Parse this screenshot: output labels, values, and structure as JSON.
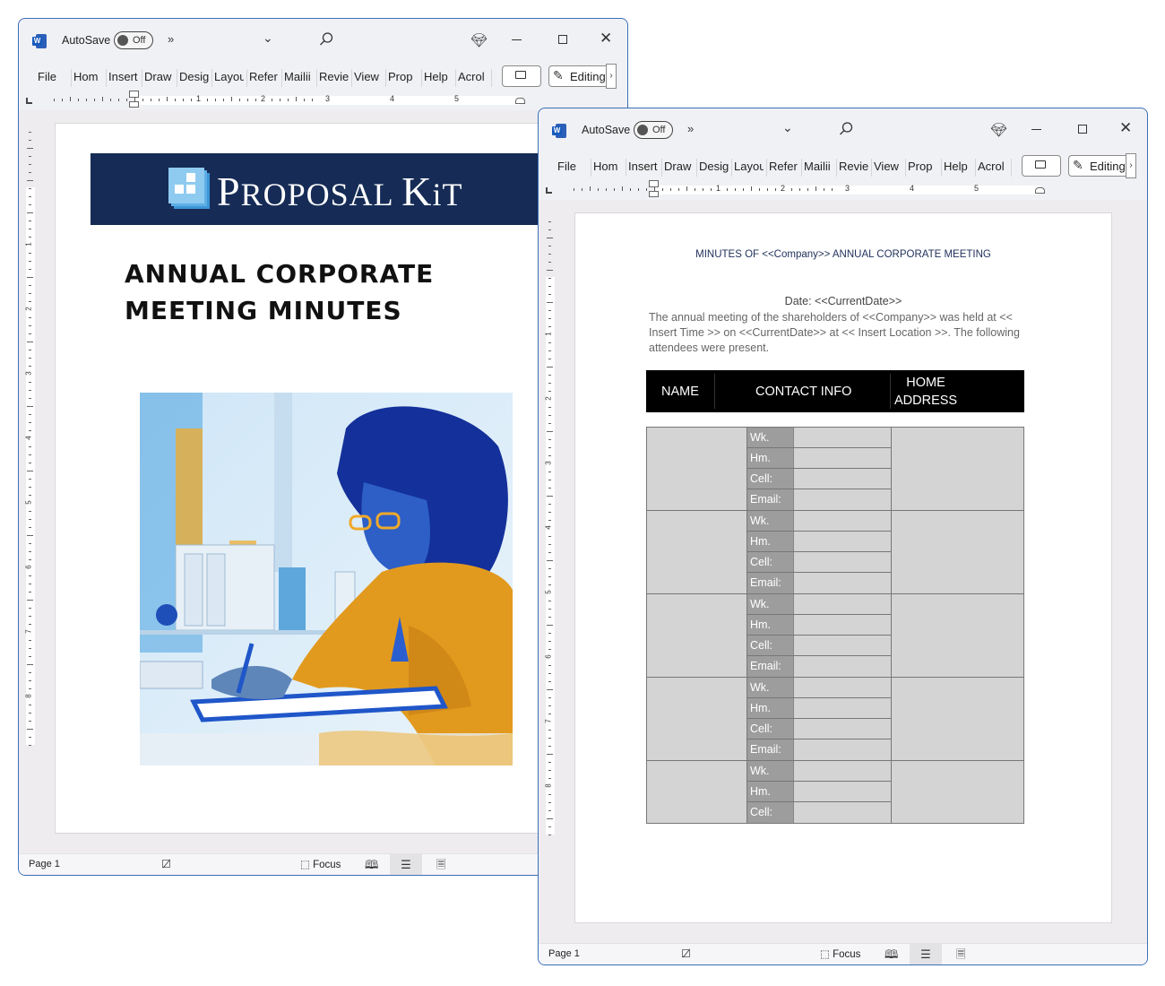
{
  "windows": [
    {
      "id": "cover",
      "titlebar": {
        "app_icon": "word-icon",
        "autosave_label": "AutoSave",
        "autosave_state": "Off",
        "more": "»",
        "dropdown": "⌄",
        "icons": [
          "search-icon",
          "diamond-icon",
          "minimize-icon",
          "maximize-icon",
          "close-icon"
        ]
      },
      "ribbon": {
        "tabs": [
          "File",
          "Hom",
          "Insert",
          "Draw",
          "Desig",
          "Layou",
          "Refer",
          "Mailii",
          "Revie",
          "View",
          "Prop",
          "Help",
          "Acrol"
        ],
        "comment_icon": "comment-icon",
        "editing_label": "Editing",
        "editing_more": "›"
      },
      "ruler": {
        "numbers": [
          "1",
          "2",
          "3",
          "4",
          "5"
        ]
      },
      "vruler": {
        "numbers": [
          "1",
          "2",
          "3",
          "4",
          "5",
          "6",
          "7",
          "8"
        ]
      },
      "document": {
        "brand": {
          "first": "P",
          "rest": "ROPOSAL ",
          "k": "K",
          "it": "iT"
        },
        "title_line1": "ANNUAL CORPORATE",
        "title_line2": "MEETING MINUTES",
        "image_alt": "Watercolor illustration of a woman with glasses writing on a clipboard at a desk"
      },
      "status": {
        "page": "Page 1",
        "focus": "Focus"
      }
    },
    {
      "id": "minutes",
      "titlebar": {
        "app_icon": "word-icon",
        "autosave_label": "AutoSave",
        "autosave_state": "Off",
        "more": "»",
        "dropdown": "⌄",
        "icons": [
          "search-icon",
          "diamond-icon",
          "minimize-icon",
          "maximize-icon",
          "close-icon"
        ]
      },
      "ribbon": {
        "tabs": [
          "File",
          "Hom",
          "Insert",
          "Draw",
          "Desig",
          "Layou",
          "Refer",
          "Mailii",
          "Revie",
          "View",
          "Prop",
          "Help",
          "Acrol"
        ],
        "comment_icon": "comment-icon",
        "editing_label": "Editing",
        "editing_more": "›"
      },
      "ruler": {
        "numbers": [
          "1",
          "2",
          "3",
          "4",
          "5"
        ]
      },
      "vruler": {
        "numbers": [
          "1",
          "2",
          "3",
          "4",
          "5",
          "6",
          "7",
          "8"
        ]
      },
      "document": {
        "heading": "MINUTES OF <<Company>> ANNUAL CORPORATE MEETING",
        "date": "Date: <<CurrentDate>>",
        "paragraph": "The annual meeting of the shareholders of <<Company>> was held at << Insert Time >> on <<CurrentDate>> at << Insert Location >>. The following attendees were present.",
        "table_headers": [
          "NAME",
          "CONTACT INFO",
          "HOME ADDRESS"
        ],
        "contact_labels": [
          "Wk.",
          "Hm.",
          "Cell:",
          "Email:"
        ],
        "groups": [
          {
            "labels": [
              "Wk.",
              "Hm.",
              "Cell:",
              "Email:"
            ]
          },
          {
            "labels": [
              "Wk.",
              "Hm.",
              "Cell:",
              "Email:"
            ]
          },
          {
            "labels": [
              "Wk.",
              "Hm.",
              "Cell:",
              "Email:"
            ]
          },
          {
            "labels": [
              "Wk.",
              "Hm.",
              "Cell:",
              "Email:"
            ]
          },
          {
            "labels": [
              "Wk.",
              "Hm.",
              "Cell:"
            ]
          }
        ]
      },
      "status": {
        "page": "Page 1",
        "focus": "Focus"
      }
    }
  ],
  "colors": {
    "window_border": "#3a6fb8",
    "banner": "#162c56",
    "heading_text": "#1f2f5a",
    "table_header_bg": "#000000",
    "table_cell_bg": "#d4d4d4",
    "label_col_bg": "#9d9d9d"
  }
}
